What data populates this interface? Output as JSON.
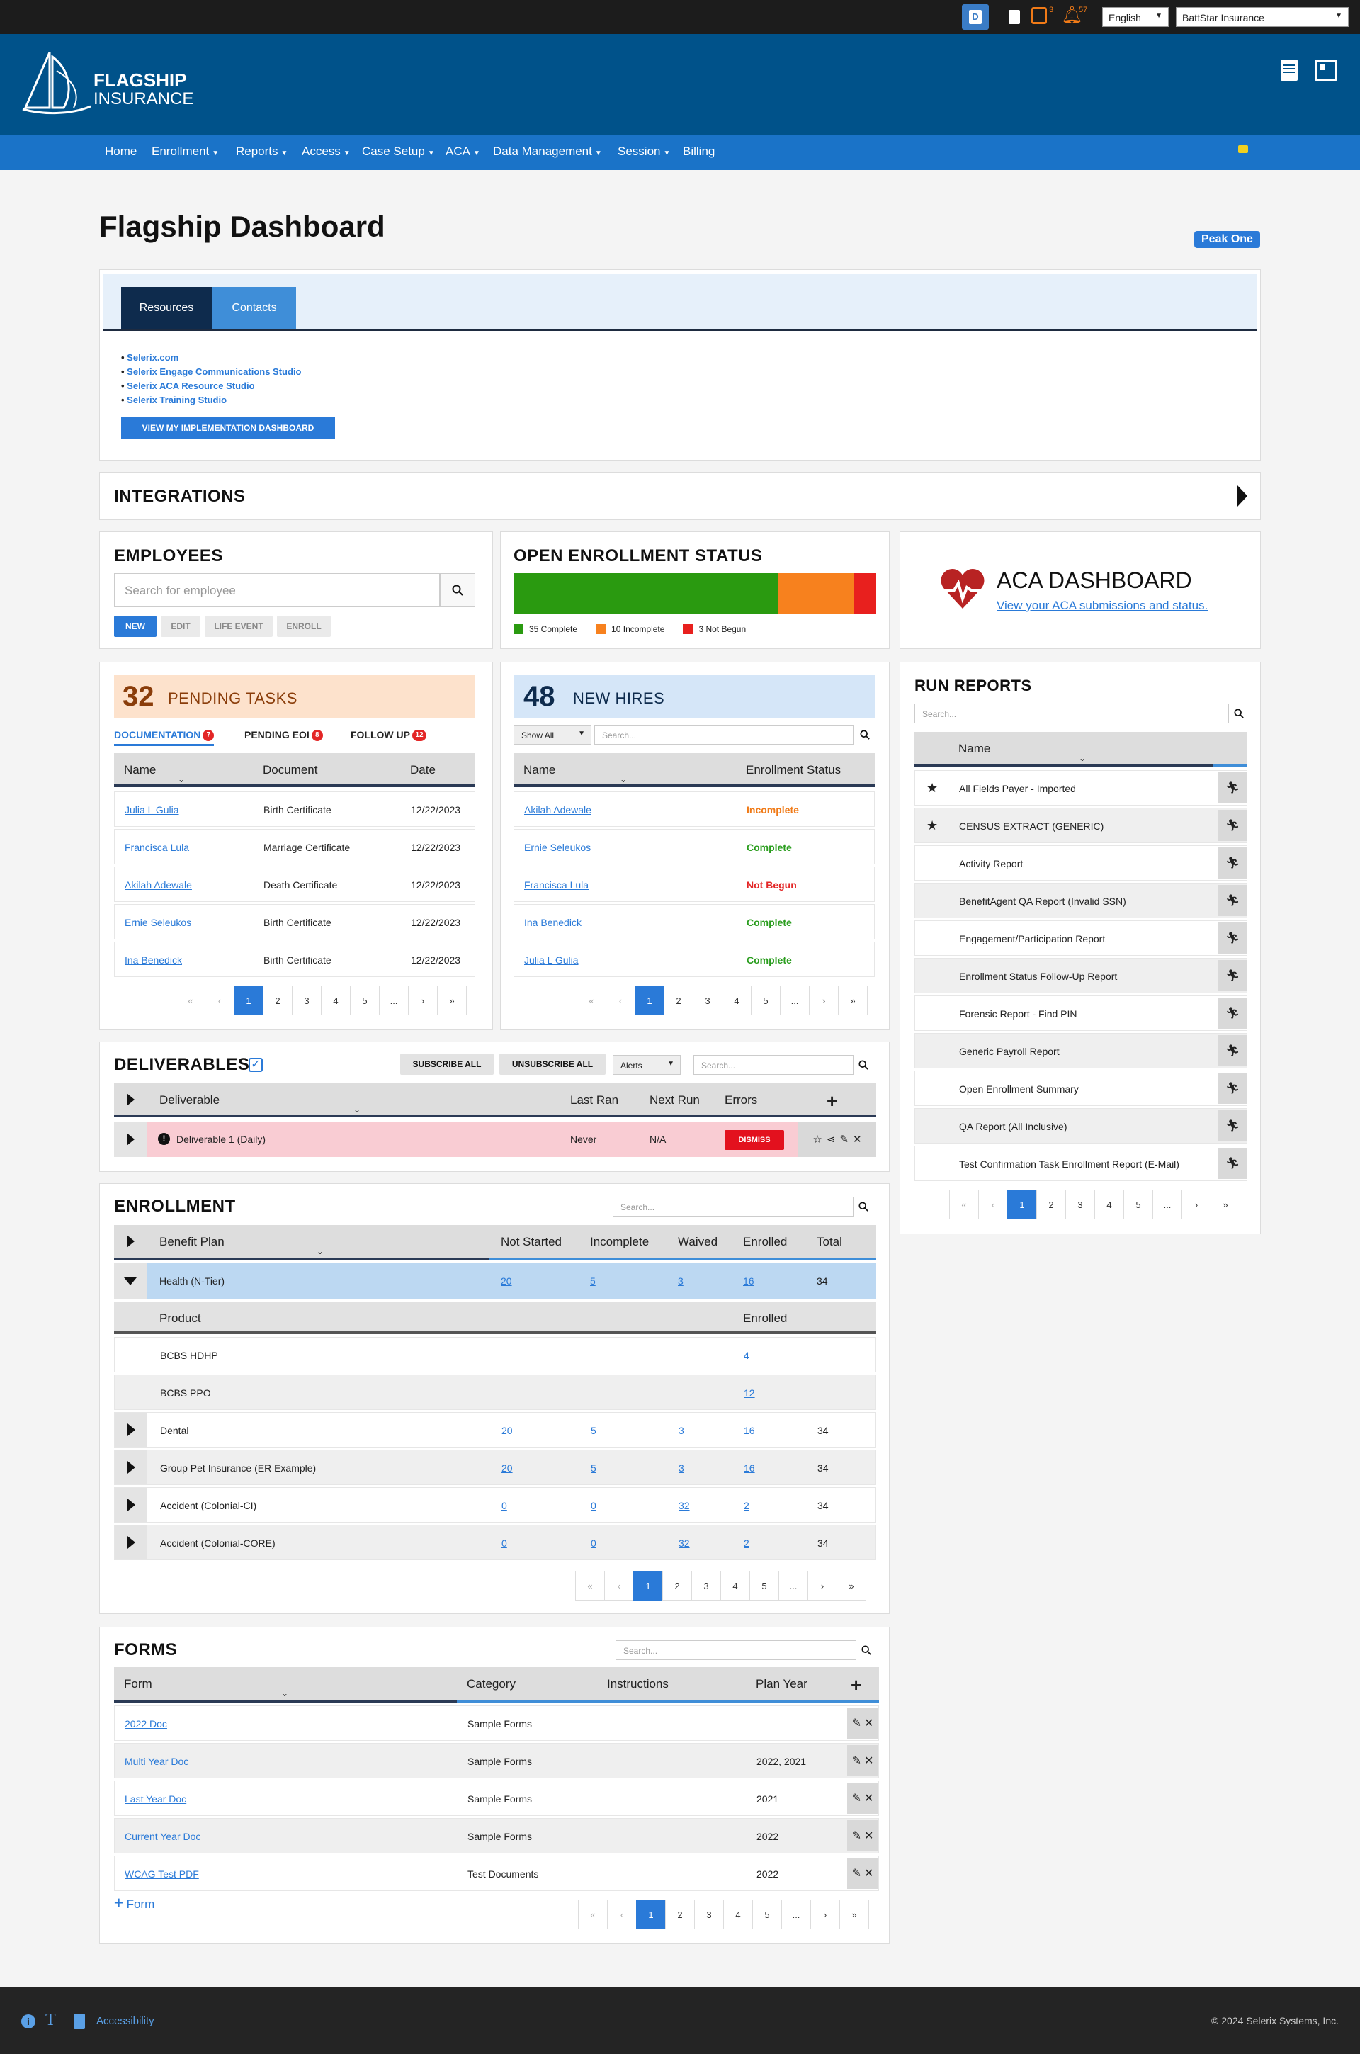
{
  "topbar": {
    "tasks_count": "3",
    "alerts_count": "57",
    "language": "English",
    "company": "BattStar Insurance"
  },
  "brand": {
    "line1": "FLAGSHIP",
    "line2": "INSURANCE"
  },
  "nav": {
    "items": [
      "Home",
      "Enrollment",
      "Reports",
      "Access",
      "Case Setup",
      "ACA",
      "Data Management",
      "Session",
      "Billing"
    ]
  },
  "page": {
    "title": "Flagship Dashboard",
    "badge": "Peak One"
  },
  "resources": {
    "tabs": [
      "Resources",
      "Contacts"
    ],
    "links": [
      "Selerix.com",
      "Selerix Engage Communications Studio",
      "Selerix ACA Resource Studio",
      "Selerix Training Studio"
    ],
    "button": "VIEW MY IMPLEMENTATION DASHBOARD"
  },
  "integrations": {
    "title": "INTEGRATIONS"
  },
  "employees": {
    "title": "EMPLOYEES",
    "search_placeholder": "Search for employee",
    "buttons": [
      "NEW",
      "EDIT",
      "LIFE EVENT",
      "ENROLL"
    ]
  },
  "oe_status": {
    "title": "OPEN ENROLLMENT STATUS",
    "segments": [
      {
        "label": "35 Complete",
        "value": 35,
        "color": "#2a9a10"
      },
      {
        "label": "10 Incomplete",
        "value": 10,
        "color": "#f7811e"
      },
      {
        "label": "3 Not Begun",
        "value": 3,
        "color": "#e8201e"
      }
    ]
  },
  "aca": {
    "title": "ACA DASHBOARD",
    "link": "View your ACA submissions and status."
  },
  "pending": {
    "count": "32",
    "title": "PENDING TASKS",
    "tabs": [
      {
        "label": "DOCUMENTATION",
        "badge": "7"
      },
      {
        "label": "PENDING EOI",
        "badge": "8"
      },
      {
        "label": "FOLLOW UP",
        "badge": "12"
      }
    ],
    "columns": [
      "Name",
      "Document",
      "Date"
    ],
    "rows": [
      [
        "Julia L Gulia",
        "Birth Certificate",
        "12/22/2023"
      ],
      [
        "Francisca Lula",
        "Marriage Certificate",
        "12/22/2023"
      ],
      [
        "Akilah Adewale",
        "Death Certificate",
        "12/22/2023"
      ],
      [
        "Ernie Seleukos",
        "Birth Certificate",
        "12/22/2023"
      ],
      [
        "Ina Benedick",
        "Birth Certificate",
        "12/22/2023"
      ]
    ]
  },
  "newhires": {
    "count": "48",
    "title": "NEW HIRES",
    "filter": "Show All",
    "search_placeholder": "Search...",
    "columns": [
      "Name",
      "Enrollment Status"
    ],
    "rows": [
      [
        "Akilah Adewale",
        "Incomplete"
      ],
      [
        "Ernie Seleukos",
        "Complete"
      ],
      [
        "Francisca Lula",
        "Not Begun"
      ],
      [
        "Ina Benedick",
        "Complete"
      ],
      [
        "Julia L Gulia",
        "Complete"
      ]
    ]
  },
  "pager": [
    "«",
    "‹",
    "1",
    "2",
    "3",
    "4",
    "5",
    "...",
    "›",
    "»"
  ],
  "reports": {
    "title": "RUN REPORTS",
    "search_placeholder": "Search...",
    "column": "Name",
    "rows": [
      {
        "name": "All Fields Payer - Imported",
        "star": "★"
      },
      {
        "name": "CENSUS EXTRACT (GENERIC)",
        "star": "★"
      },
      {
        "name": "Activity Report",
        "star": ""
      },
      {
        "name": "BenefitAgent QA Report (Invalid SSN)",
        "star": ""
      },
      {
        "name": "Engagement/Participation Report",
        "star": ""
      },
      {
        "name": "Enrollment Status Follow-Up Report",
        "star": ""
      },
      {
        "name": "Forensic Report - Find PIN",
        "star": ""
      },
      {
        "name": "Generic Payroll Report",
        "star": ""
      },
      {
        "name": "Open Enrollment Summary",
        "star": ""
      },
      {
        "name": "QA Report (All Inclusive)",
        "star": ""
      },
      {
        "name": "Test Confirmation Task Enrollment Report (E-Mail)",
        "star": ""
      }
    ]
  },
  "deliverables": {
    "title": "DELIVERABLES",
    "subscribe": "SUBSCRIBE ALL",
    "unsubscribe": "UNSUBSCRIBE ALL",
    "filter": "Alerts",
    "search_placeholder": "Search...",
    "columns": [
      "Deliverable",
      "Last Ran",
      "Next Run",
      "Errors"
    ],
    "row": {
      "name": "Deliverable 1 (Daily)",
      "last": "Never",
      "next": "N/A",
      "dismiss": "DISMISS"
    }
  },
  "enrollment": {
    "title": "ENROLLMENT",
    "search_placeholder": "Search...",
    "columns": [
      "Benefit Plan",
      "Not Started",
      "Incomplete",
      "Waived",
      "Enrolled",
      "Total"
    ],
    "expanded": {
      "name": "Health (N-Tier)",
      "vals": [
        "20",
        "5",
        "3",
        "16",
        "34"
      ]
    },
    "sub_columns": [
      "Product",
      "Enrolled"
    ],
    "sub_rows": [
      [
        "BCBS HDHP",
        "4"
      ],
      [
        "BCBS PPO",
        "12"
      ]
    ],
    "rows": [
      {
        "name": "Dental",
        "vals": [
          "20",
          "5",
          "3",
          "16",
          "34"
        ]
      },
      {
        "name": "Group Pet Insurance (ER Example)",
        "vals": [
          "20",
          "5",
          "3",
          "16",
          "34"
        ]
      },
      {
        "name": "Accident (Colonial-CI)",
        "vals": [
          "0",
          "0",
          "32",
          "2",
          "34"
        ]
      },
      {
        "name": "Accident (Colonial-CORE)",
        "vals": [
          "0",
          "0",
          "32",
          "2",
          "34"
        ]
      }
    ]
  },
  "forms": {
    "title": "FORMS",
    "search_placeholder": "Search...",
    "columns": [
      "Form",
      "Category",
      "Instructions",
      "Plan Year"
    ],
    "rows": [
      [
        "2022 Doc",
        "Sample Forms",
        "",
        ""
      ],
      [
        "Multi Year Doc",
        "Sample Forms",
        "",
        "2022, 2021"
      ],
      [
        "Last Year Doc",
        "Sample Forms",
        "",
        "2021"
      ],
      [
        "Current Year Doc",
        "Sample Forms",
        "",
        "2022"
      ],
      [
        "WCAG Test PDF",
        "Test Documents",
        "",
        "2022"
      ]
    ],
    "add": "Form"
  },
  "footer": {
    "accessibility": "Accessibility",
    "copyright": "© 2024 Selerix Systems, Inc."
  }
}
